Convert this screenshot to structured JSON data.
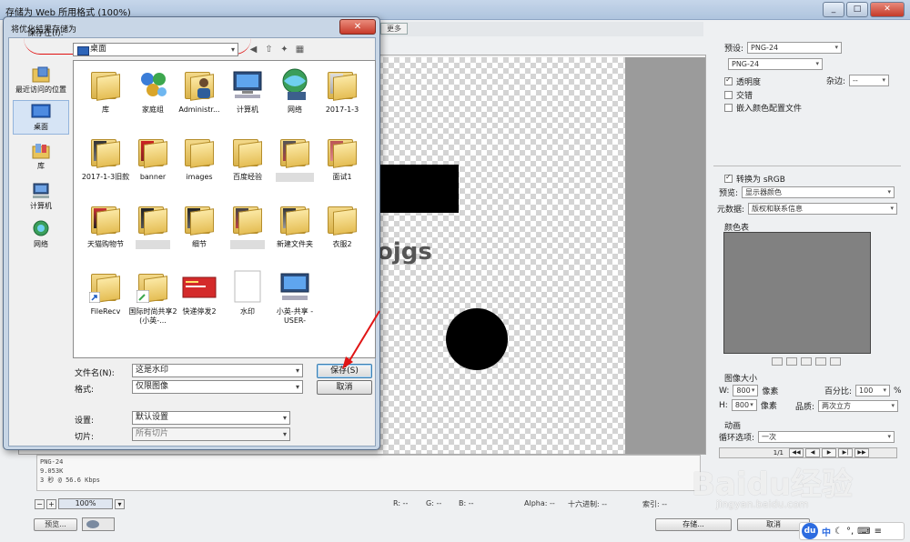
{
  "main_window": {
    "title": "存储为 Web 所用格式 (100%)",
    "tab_more": "更多",
    "canvas_text": "ojgs",
    "info_lines": [
      "PNG-24",
      "9.053K",
      "3 秒 @ 56.6 Kbps"
    ],
    "zoom": "100%",
    "status": {
      "r": "R: --",
      "g": "G: --",
      "b": "B: --",
      "alpha": "Alpha: --",
      "hex": "十六进制: --",
      "index": "索引: --"
    },
    "preview_button": "预览...",
    "save_button": "存储...",
    "cancel_button": "取消"
  },
  "right_panel": {
    "preset_label": "预设:",
    "preset_value": "PNG-24",
    "format_value": "PNG-24",
    "transparency_label": "透明度",
    "matte_label": "杂边:",
    "matte_value": "--",
    "interlaced_label": "交错",
    "embed_profile_label": "嵌入颜色配置文件",
    "convert_srgb_label": "转换为 sRGB",
    "preview_label": "预览:",
    "preview_value": "显示器颜色",
    "metadata_label": "元数据:",
    "metadata_value": "版权和联系信息",
    "color_table_label": "颜色表",
    "image_size_label": "图像大小",
    "w_label": "W:",
    "w_value": "800",
    "h_label": "H:",
    "h_value": "800",
    "px_unit": "像素",
    "percent_label": "百分比:",
    "percent_value": "100",
    "percent_unit": "%",
    "quality_label": "品质:",
    "quality_value": "两次立方",
    "animation_label": "动画",
    "loop_label": "循环选项:",
    "loop_value": "一次",
    "frame_counter": "1/1"
  },
  "dialog": {
    "title": "将优化结果存储为",
    "close_symbol": "✕",
    "save_in_label": "保存在(I):",
    "save_in_value": "桌面",
    "places": [
      {
        "label": "最近访问的位置"
      },
      {
        "label": "桌面"
      },
      {
        "label": "库"
      },
      {
        "label": "计算机"
      },
      {
        "label": "网络"
      }
    ],
    "items": [
      {
        "label": "库"
      },
      {
        "label": "家庭组"
      },
      {
        "label": "Administr..."
      },
      {
        "label": "计算机"
      },
      {
        "label": "网络"
      },
      {
        "label": "2017-1-3"
      },
      {
        "label": "2017-1-3旧款"
      },
      {
        "label": "banner"
      },
      {
        "label": "images"
      },
      {
        "label": "百度经验"
      },
      {
        "label": ""
      },
      {
        "label": "面试1"
      },
      {
        "label": "天猫购物节"
      },
      {
        "label": ""
      },
      {
        "label": "细节"
      },
      {
        "label": ""
      },
      {
        "label": "新建文件夹"
      },
      {
        "label": "衣服2"
      },
      {
        "label": "FileRecv"
      },
      {
        "label": "国际时尚共享2 (小英-..."
      },
      {
        "label": "快递停发2"
      },
      {
        "label": "水印"
      },
      {
        "label": "小英-共享 -USER-"
      }
    ],
    "filename_label": "文件名(N):",
    "filename_value": "这是水印",
    "format_label": "格式:",
    "format_value": "仅限图像",
    "settings_label": "设置:",
    "settings_value": "默认设置",
    "slices_label": "切片:",
    "slices_value": "所有切片",
    "save_button": "保存(S)",
    "cancel_button": "取消"
  },
  "watermark": {
    "brand": "Baidu经验",
    "url": "jingyan.baidu.com"
  },
  "ime": {
    "logo": "du",
    "lang": "中"
  }
}
